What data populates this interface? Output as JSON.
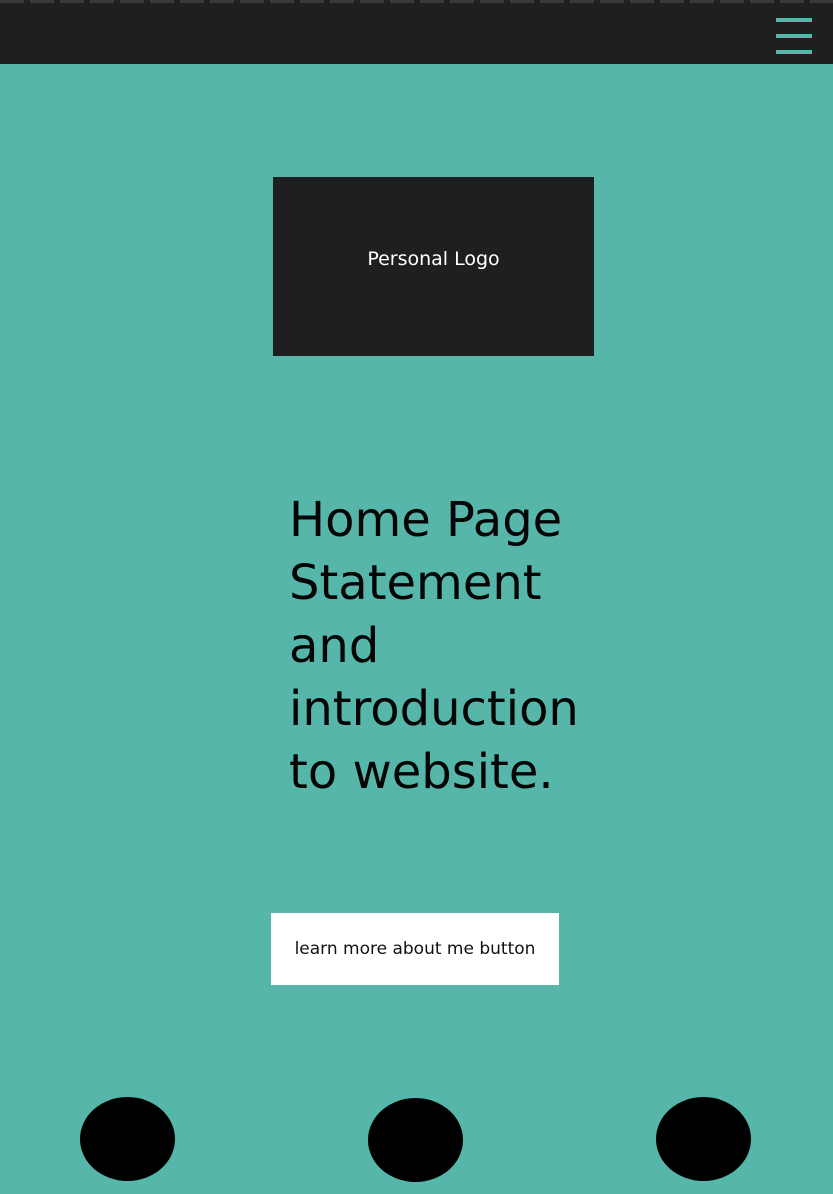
{
  "header": {
    "menu_icon": "hamburger-menu-icon"
  },
  "logo": {
    "label": "Personal Logo"
  },
  "statement": {
    "text": "Home Page Statement and introduction to website."
  },
  "cta": {
    "label": "learn more about me button"
  },
  "social_links": [
    {
      "icon": "circle-icon"
    },
    {
      "icon": "circle-icon"
    },
    {
      "icon": "circle-icon"
    }
  ],
  "colors": {
    "background": "#56b6aa",
    "header": "#1f1f21",
    "logo_box": "#1f1f21",
    "button": "#ffffff",
    "circles": "#000000",
    "menu_icon": "#56b6aa"
  }
}
